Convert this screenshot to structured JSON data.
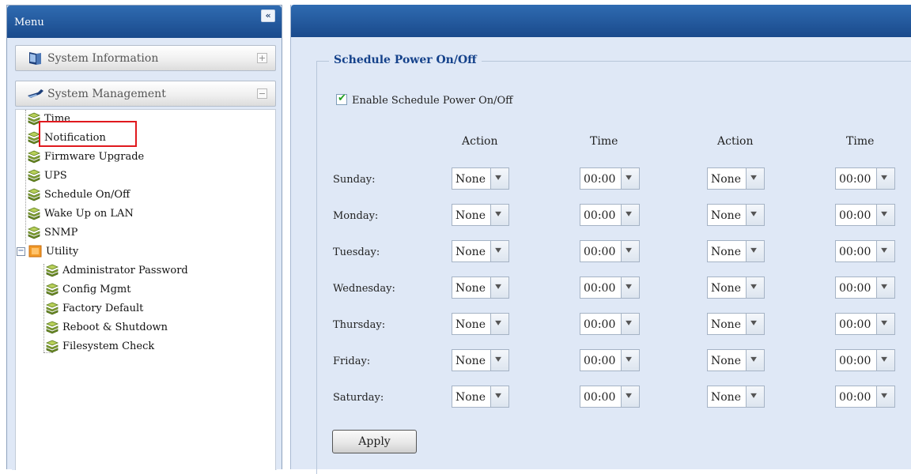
{
  "menu": {
    "title": "Menu",
    "collapse_glyph": "«",
    "sections": [
      {
        "label": "System Information",
        "toggle": "+",
        "icon": "monitor-icon"
      },
      {
        "label": "System Management",
        "toggle": "−",
        "icon": "wrench-icon"
      }
    ],
    "items": [
      {
        "label": "Time",
        "icon": "layer-stack-icon"
      },
      {
        "label": "Notification",
        "icon": "layer-stack-icon"
      },
      {
        "label": "Firmware Upgrade",
        "icon": "layer-stack-icon"
      },
      {
        "label": "UPS",
        "icon": "layer-stack-icon"
      },
      {
        "label": "Schedule On/Off",
        "icon": "layer-stack-icon",
        "selected": true
      },
      {
        "label": "Wake Up on LAN",
        "icon": "layer-stack-icon"
      },
      {
        "label": "SNMP",
        "icon": "layer-stack-icon"
      }
    ],
    "utility": {
      "toggle": "−",
      "label": "Utility",
      "icon": "folder-icon",
      "children": [
        {
          "label": "Administrator Password",
          "icon": "layer-stack-icon"
        },
        {
          "label": "Config Mgmt",
          "icon": "layer-stack-icon"
        },
        {
          "label": "Factory Default",
          "icon": "layer-stack-icon"
        },
        {
          "label": "Reboot & Shutdown",
          "icon": "layer-stack-icon"
        },
        {
          "label": "Filesystem Check",
          "icon": "layer-stack-icon"
        }
      ]
    }
  },
  "schedule": {
    "legend": "Schedule Power On/Off",
    "enable_label": "Enable Schedule Power On/Off",
    "enable_checked": true,
    "columns": [
      "Action",
      "Time",
      "Action",
      "Time"
    ],
    "rows": [
      {
        "day": "Sunday:",
        "action1": "None",
        "time1": "00:00",
        "action2": "None",
        "time2": "00:00"
      },
      {
        "day": "Monday:",
        "action1": "None",
        "time1": "00:00",
        "action2": "None",
        "time2": "00:00"
      },
      {
        "day": "Tuesday:",
        "action1": "None",
        "time1": "00:00",
        "action2": "None",
        "time2": "00:00"
      },
      {
        "day": "Wednesday:",
        "action1": "None",
        "time1": "00:00",
        "action2": "None",
        "time2": "00:00"
      },
      {
        "day": "Thursday:",
        "action1": "None",
        "time1": "00:00",
        "action2": "None",
        "time2": "00:00"
      },
      {
        "day": "Friday:",
        "action1": "None",
        "time1": "00:00",
        "action2": "None",
        "time2": "00:00"
      },
      {
        "day": "Saturday:",
        "action1": "None",
        "time1": "00:00",
        "action2": "None",
        "time2": "00:00"
      }
    ],
    "apply_label": "Apply"
  },
  "colors": {
    "header_blue": "#1a4a8c",
    "panel_bg": "#dfe8f6",
    "legend_text": "#15428b",
    "highlight": "#e0191e"
  }
}
